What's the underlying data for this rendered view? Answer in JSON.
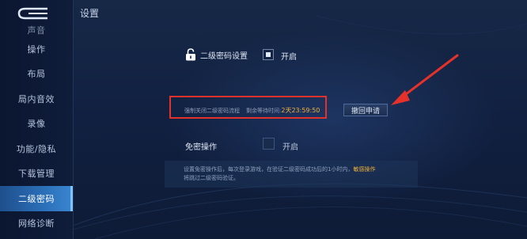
{
  "header": {
    "title": "设置"
  },
  "sidebar": {
    "partial_item": "声音",
    "items": [
      {
        "label": "操作"
      },
      {
        "label": "布局"
      },
      {
        "label": "局内音效"
      },
      {
        "label": "录像"
      },
      {
        "label": "功能/隐私"
      },
      {
        "label": "下载管理"
      },
      {
        "label": "二级密码",
        "active": true
      },
      {
        "label": "网络诊断"
      }
    ]
  },
  "second_password": {
    "label": "二级密码设置",
    "checkbox_checked": true,
    "option_label": "开启",
    "close_process_label": "强制关闭二级密码流程",
    "remaining_label": "剩余等待时间:",
    "remaining_time": "2天23:59:50",
    "revoke_button": "撤回申请"
  },
  "no_password": {
    "label": "免密操作",
    "checkbox_checked": false,
    "option_label": "开启",
    "notice_text": "设置免密操作后，每次登录游戏，在验证二级密码成功后的1小时内，",
    "notice_highlight": "敏感操作",
    "notice_text2": "将跳过二级密码验证。"
  },
  "colors": {
    "accent": "#f0b23b",
    "highlight_border": "#e4322a",
    "active_sidebar": "#2a6fb8"
  },
  "icons": {
    "back": "back-arrow-icon",
    "lock": "lock-icon"
  }
}
